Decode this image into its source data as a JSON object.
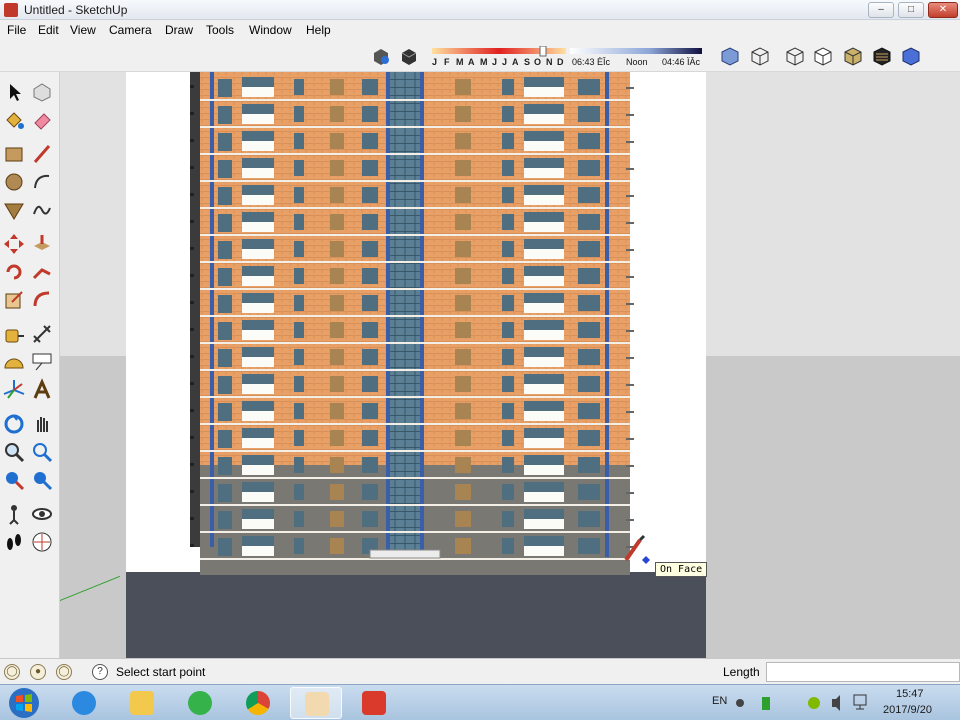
{
  "window": {
    "title": "Untitled - SketchUp"
  },
  "menu": [
    "File",
    "Edit",
    "View",
    "Camera",
    "Draw",
    "Tools",
    "Window",
    "Help"
  ],
  "shadow": {
    "months": [
      "J",
      "F",
      "M",
      "A",
      "M",
      "J",
      "J",
      "A",
      "S",
      "O",
      "N",
      "D"
    ],
    "start_time": "06:43 ÈÎc",
    "noon": "Noon",
    "end_time": "04:46 ÏÂc"
  },
  "viewport": {
    "tooltip": "On Face"
  },
  "status": {
    "prompt": "Select start point",
    "length_label": "Length",
    "length_value": ""
  },
  "taskbar": {
    "lang": "EN",
    "time": "15:47",
    "date": "2017/9/20"
  },
  "colors": {
    "brick": "#e8a066",
    "glass": "#5b8095",
    "base": "#6a6a6a"
  }
}
